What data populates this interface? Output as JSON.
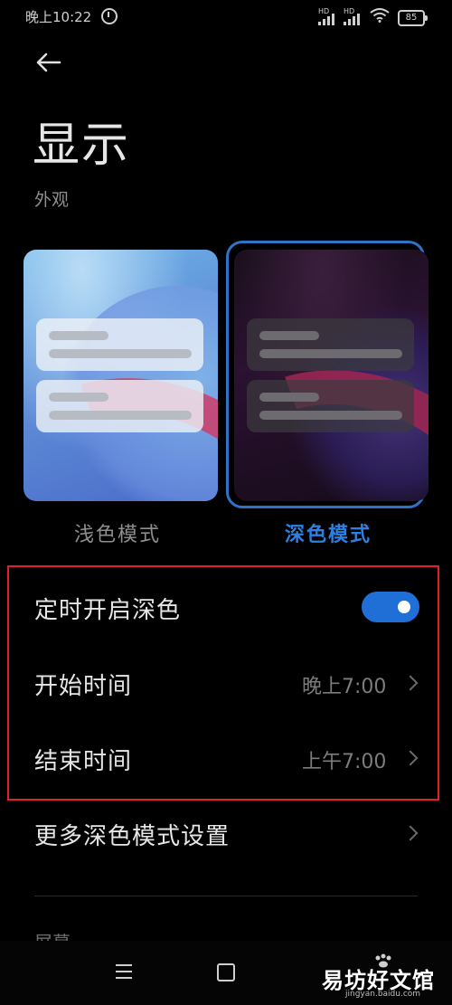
{
  "status_bar": {
    "time": "晚上10:22",
    "battery": "85",
    "signal_label": "HD"
  },
  "header": {
    "title": "显示"
  },
  "appearance": {
    "section_label": "外观",
    "light_mode_label": "浅色模式",
    "dark_mode_label": "深色模式",
    "selected": "深色模式"
  },
  "schedule": {
    "toggle_label": "定时开启深色",
    "toggle_on": true,
    "start_label": "开始时间",
    "start_value": "晚上7:00",
    "end_label": "结束时间",
    "end_value": "上午7:00"
  },
  "more_settings": {
    "label": "更多深色模式设置"
  },
  "next_section_partial": "屏幕",
  "watermark": {
    "text": "易坊好文馆",
    "sub": "jingyan.baidu.com"
  },
  "colors": {
    "accent": "#2f7fe0",
    "toggle_on": "#1f6fd6",
    "highlight_border": "#e0202a",
    "background": "#000000"
  }
}
